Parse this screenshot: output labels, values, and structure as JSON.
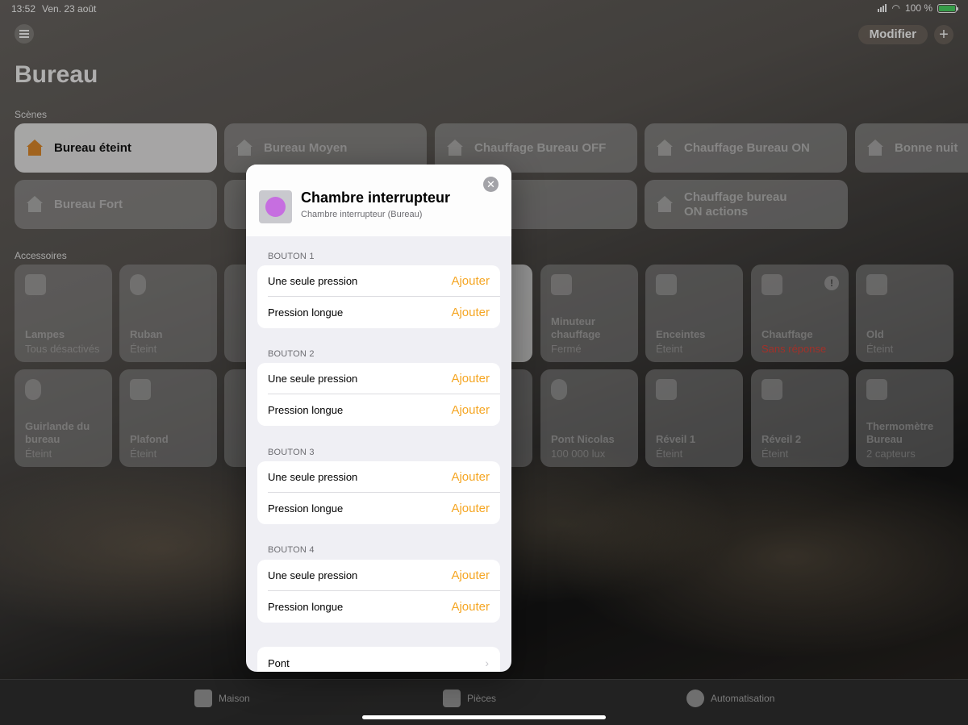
{
  "status": {
    "time": "13:52",
    "date": "Ven. 23 août",
    "battery": "100 %"
  },
  "nav": {
    "modify_label": "Modifier",
    "add_label": "+"
  },
  "page": {
    "title": "Bureau",
    "scenes_label": "Scènes",
    "accessories_label": "Accessoires"
  },
  "scenes": [
    {
      "label": "Bureau éteint",
      "active": true
    },
    {
      "label": "Bureau Moyen"
    },
    {
      "label": "Chauffage Bureau OFF"
    },
    {
      "label": "Chauffage Bureau ON"
    },
    {
      "label": "Bonne nuit"
    },
    {
      "label": "Bureau Fort"
    },
    {
      "label": "Chauffage bureau ON actions"
    }
  ],
  "accessories": [
    {
      "name": "Lampes",
      "state": "Tous désactivés"
    },
    {
      "name": "Ruban",
      "state": "Éteint"
    },
    {
      "name": "Minuteur chauffage",
      "state": "Fermé"
    },
    {
      "name": "Enceintes",
      "state": "Éteint"
    },
    {
      "name": "Chauffage",
      "state": "Sans réponse",
      "warning": "!"
    },
    {
      "name": "Old",
      "state": "Éteint"
    },
    {
      "name": "Guirlande du bureau",
      "state": "Éteint"
    },
    {
      "name": "Plafond",
      "state": "Éteint"
    },
    {
      "name": "Pont Nicolas",
      "state": "100 000 lux"
    },
    {
      "name": "Réveil 1",
      "state": "Éteint"
    },
    {
      "name": "Réveil 2",
      "state": "Éteint"
    },
    {
      "name": "Thermomètre Bureau",
      "state": "2 capteurs"
    }
  ],
  "modal": {
    "title": "Chambre interrupteur",
    "subtitle": "Chambre interrupteur (Bureau)",
    "close": "✕",
    "buttons": [
      {
        "label": "BOUTON 1",
        "single": "Une seule pression",
        "long": "Pression longue",
        "add": "Ajouter"
      },
      {
        "label": "BOUTON 2",
        "single": "Une seule pression",
        "long": "Pression longue",
        "add": "Ajouter"
      },
      {
        "label": "BOUTON 3",
        "single": "Une seule pression",
        "long": "Pression longue",
        "add": "Ajouter"
      },
      {
        "label": "BOUTON 4",
        "single": "Une seule pression",
        "long": "Pression longue",
        "add": "Ajouter"
      }
    ],
    "bridge_label": "Pont",
    "chevron": "›"
  },
  "tabs": [
    {
      "label": "Maison"
    },
    {
      "label": "Pièces"
    },
    {
      "label": "Automatisation"
    }
  ]
}
